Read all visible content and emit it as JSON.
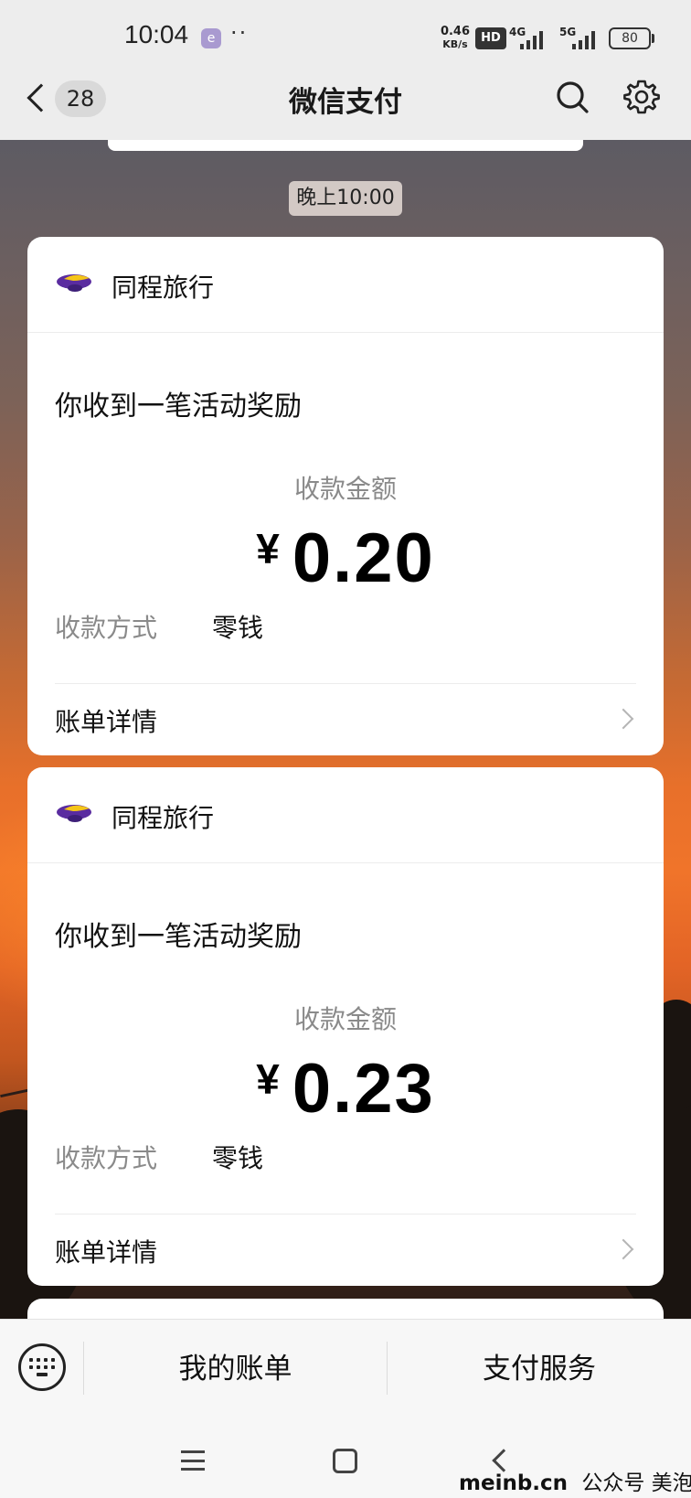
{
  "status_bar": {
    "time": "10:04",
    "more": "··",
    "speed_value": "0.46",
    "speed_unit": "KB/s",
    "hd_badge": "HD",
    "net1": "4G",
    "net2": "5G",
    "battery": "80"
  },
  "header": {
    "unread_count": "28",
    "title": "微信支付"
  },
  "chat": {
    "timestamp": "晚上10:00",
    "messages": [
      {
        "merchant": "同程旅行",
        "title": "你收到一笔活动奖励",
        "amount_label": "收款金额",
        "currency": "¥",
        "amount": "0.20",
        "method_label": "收款方式",
        "method_value": "零钱",
        "detail_label": "账单详情"
      },
      {
        "merchant": "同程旅行",
        "title": "你收到一笔活动奖励",
        "amount_label": "收款金额",
        "currency": "¥",
        "amount": "0.23",
        "method_label": "收款方式",
        "method_value": "零钱",
        "detail_label": "账单详情"
      }
    ]
  },
  "bottom_bar": {
    "my_bills": "我的账单",
    "pay_services": "支付服务"
  },
  "watermark": {
    "site": "meinb.cn",
    "account": "公众号 美泡君"
  },
  "colors": {
    "page_bg": "#ededed",
    "card_bg": "#ffffff",
    "logo_purple": "#5a2ca0",
    "logo_yellow": "#f5c518",
    "sunset_orange": "#f0742a"
  }
}
